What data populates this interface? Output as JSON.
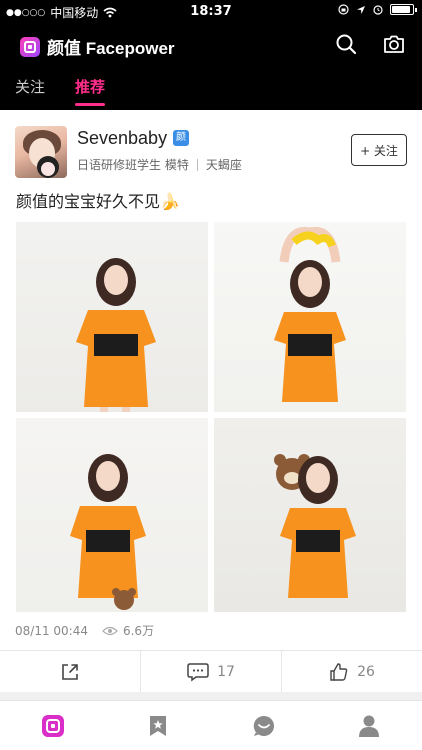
{
  "status_bar": {
    "carrier": "中国移动",
    "time": "18:37",
    "battery_level": 0.92
  },
  "header": {
    "app_title": "颜值 Facepower",
    "icons": [
      "search-icon",
      "camera-icon"
    ],
    "tabs": [
      {
        "label": "关注",
        "active": false
      },
      {
        "label": "推荐",
        "active": true
      }
    ],
    "accent_color": "#ff2d8c"
  },
  "post": {
    "username": "Sevenbaby",
    "verified_badge": "颜",
    "meta": {
      "tags": "日语研修班学生 模特",
      "zodiac": "天蝎座"
    },
    "follow_label": "+ 关注",
    "caption": "颜值的宝宝好久不见🍌",
    "photos": [
      "photo-orange-dress-1",
      "photo-orange-dress-2",
      "photo-orange-dress-3",
      "photo-orange-dress-4"
    ],
    "timestamp": "08/11 00:44",
    "views": "6.6万",
    "actions": {
      "share_icon": "share-icon",
      "comment_count": "17",
      "like_count": "26"
    }
  },
  "bottom_nav": {
    "items": [
      "home-icon",
      "bookmark-icon",
      "messages-icon",
      "profile-icon"
    ],
    "active": "home-icon"
  }
}
